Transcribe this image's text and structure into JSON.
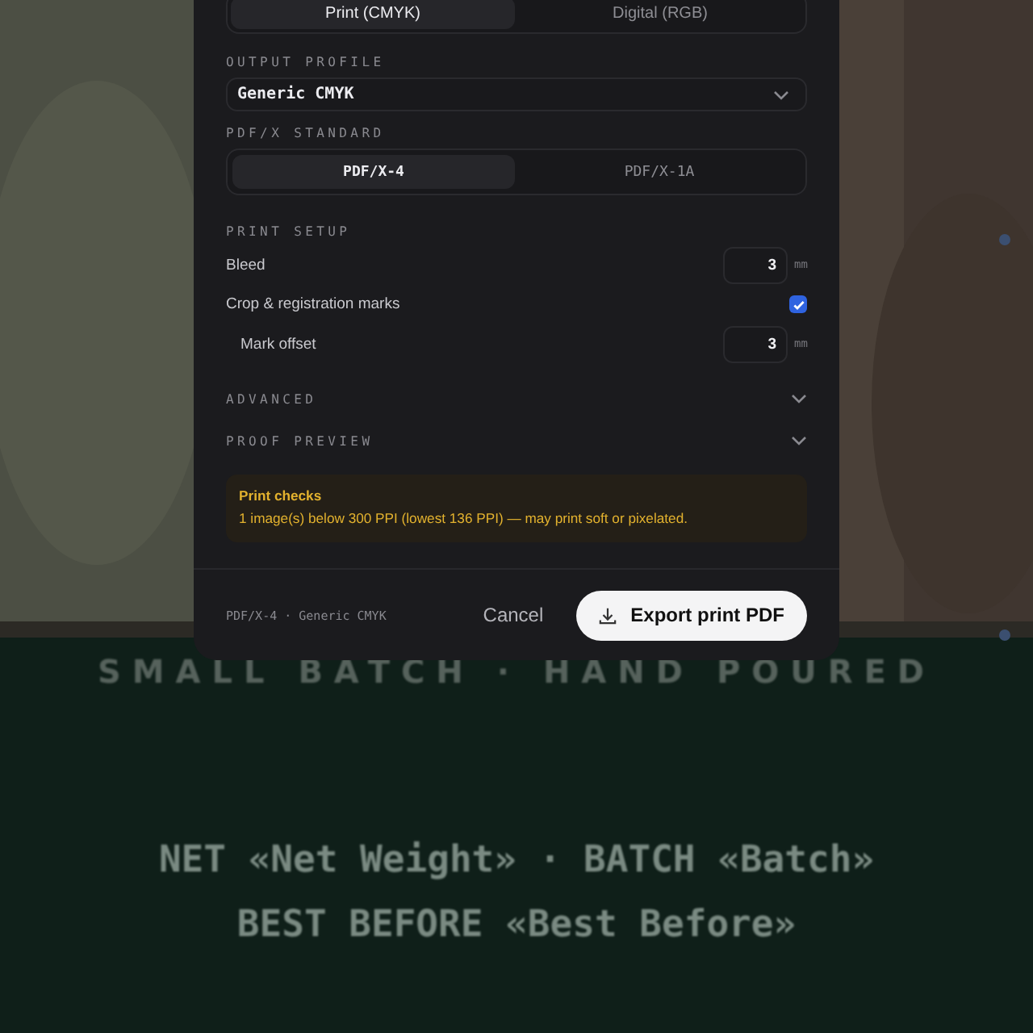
{
  "background": {
    "tagline": "SMALL BATCH · HAND POURED",
    "details": [
      "NET «Net Weight» · BATCH «Batch»",
      "BEST BEFORE «Best Before»"
    ]
  },
  "dialog": {
    "color_mode": [
      {
        "label": "Print (CMYK)",
        "selected": true
      },
      {
        "label": "Digital (RGB)",
        "selected": false
      }
    ],
    "output_profile": {
      "label": "OUTPUT PROFILE",
      "value": "Generic CMYK"
    },
    "pdfx_standard": {
      "label": "PDF/X STANDARD",
      "options": [
        {
          "label": "PDF/X-4",
          "selected": true
        },
        {
          "label": "PDF/X-1A",
          "selected": false
        }
      ]
    },
    "print_setup": {
      "label": "PRINT SETUP",
      "rows": [
        {
          "kind": "number",
          "label": "Bleed",
          "value": "3",
          "unit": "mm",
          "indented": false
        },
        {
          "kind": "checkbox",
          "label": "Crop & registration marks",
          "checked": true,
          "indented": false
        },
        {
          "kind": "number",
          "label": "Mark offset",
          "value": "3",
          "unit": "mm",
          "indented": true
        }
      ]
    },
    "sections": [
      {
        "label": "ADVANCED",
        "expanded": false
      },
      {
        "label": "PROOF PREVIEW",
        "expanded": false
      }
    ],
    "warning": {
      "title": "Print checks",
      "message": "1 image(s) below 300 PPI (lowest 136 PPI) — may print soft or pixelated."
    },
    "footer": {
      "summary": "PDF/X-4 · Generic CMYK",
      "cancel": "Cancel",
      "export": "Export print PDF"
    }
  }
}
